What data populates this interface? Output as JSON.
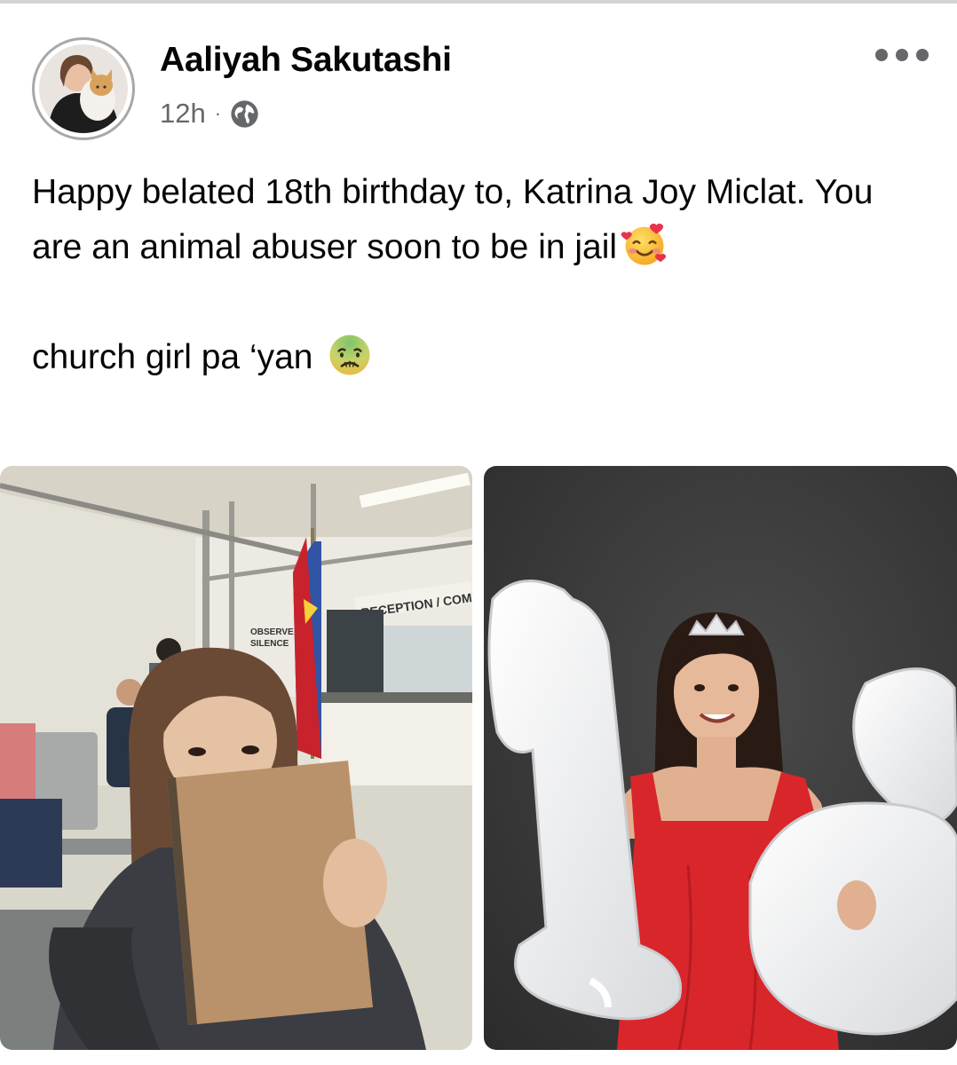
{
  "post": {
    "author": "Aaliyah Sakutashi",
    "time": "12h",
    "separator": "·",
    "privacy_icon": "globe-icon",
    "more_icon": "more-options-icon",
    "text_line1": "Happy belated 18th birthday to, Katrina Joy Miclat. You are an animal abuser soon to be in jail",
    "emoji1": "smiling-face-with-hearts",
    "text_line2": "church girl pa ‘yan",
    "emoji2": "nauseated-face"
  },
  "photos": [
    {
      "sign_reception": "RECEPTION / COMPLAI",
      "sign_observe_1": "OBSERVE",
      "sign_observe_2": "SILENCE"
    },
    {
      "balloon_number": "18"
    }
  ],
  "colors": {
    "name": "#050505",
    "meta": "#65676b",
    "dress": "#d9262b",
    "backdrop": "#3a3a3a"
  }
}
